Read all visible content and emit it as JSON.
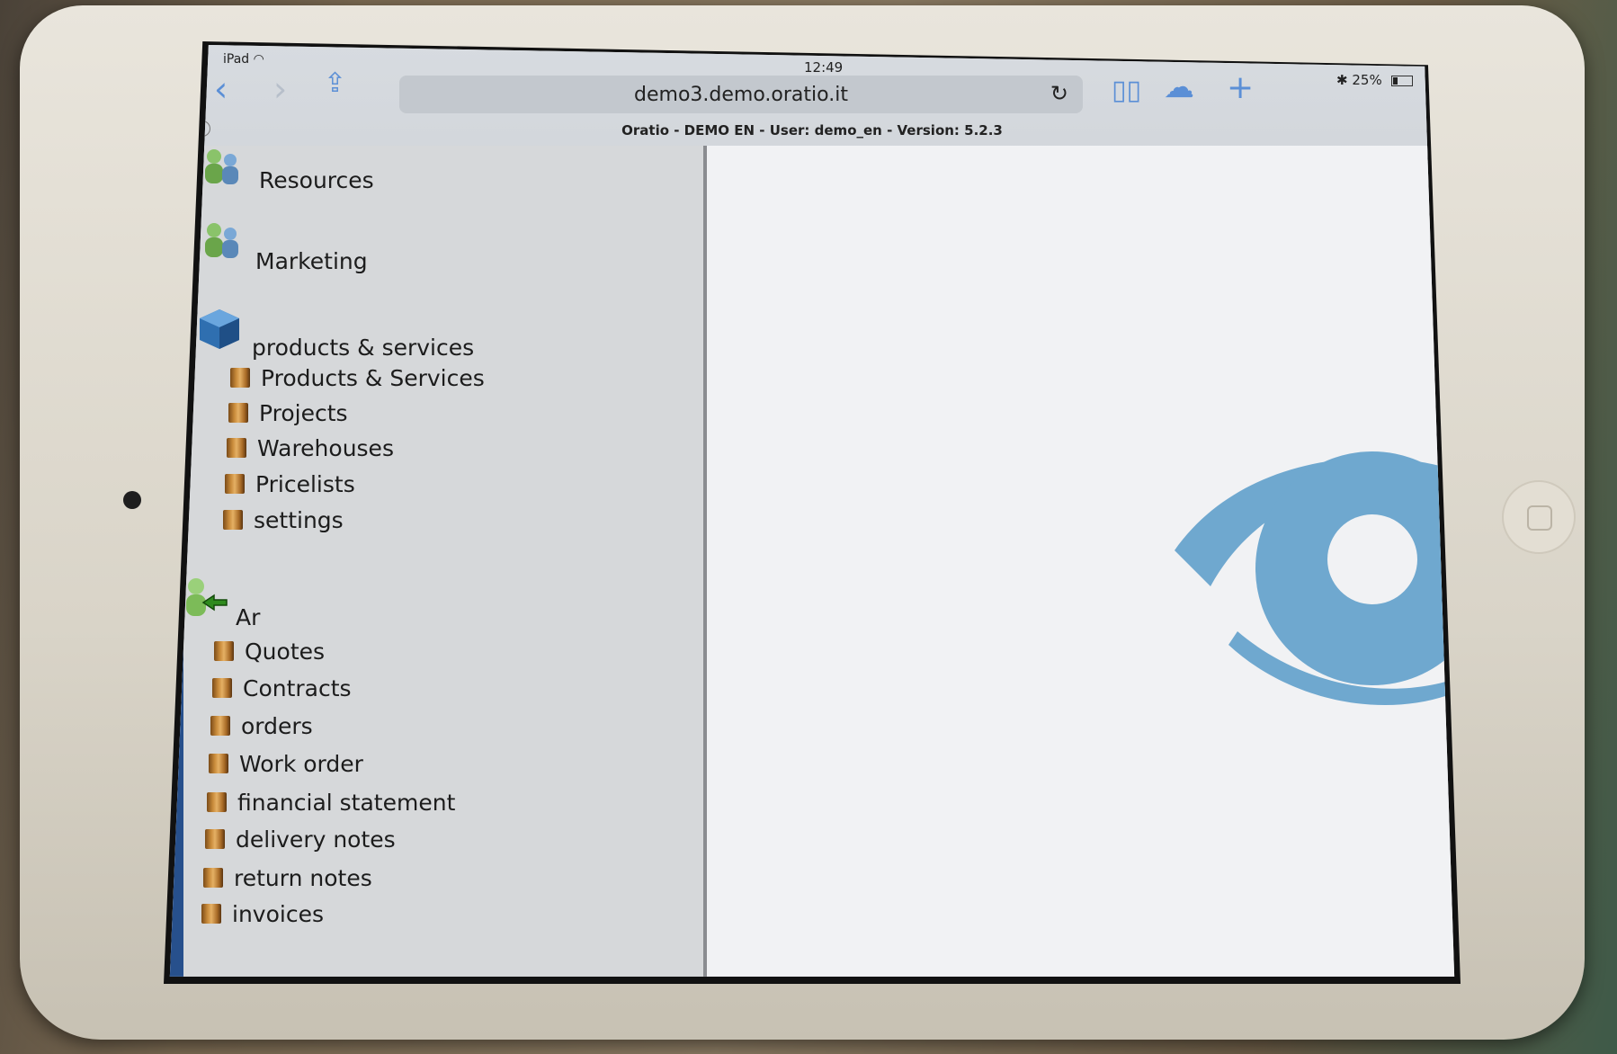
{
  "status_bar": {
    "device": "iPad",
    "time": "12:49",
    "battery": "25%"
  },
  "browser": {
    "url": "demo3.demo.oratio.it",
    "tab_title": "Oratio - DEMO EN - User: demo_en - Version: 5.2.3"
  },
  "sidebar": {
    "groups": [
      {
        "label": "Resources",
        "icon": "people-icon",
        "items": []
      },
      {
        "label": "Marketing",
        "icon": "people-icon",
        "items": []
      },
      {
        "label": "products & services",
        "icon": "cube-icon",
        "items": [
          "Products & Services",
          "Projects",
          "Warehouses",
          "Pricelists",
          "settings"
        ]
      },
      {
        "label": "Ar",
        "icon": "person-arrow-icon",
        "items": [
          "Quotes",
          "Contracts",
          "orders",
          "Work order",
          "financial statement",
          "delivery notes",
          "return notes",
          "invoices"
        ]
      }
    ]
  },
  "colors": {
    "accent": "#27508c",
    "logo": "#6fa8cf",
    "nav": "#5b8fd6"
  }
}
